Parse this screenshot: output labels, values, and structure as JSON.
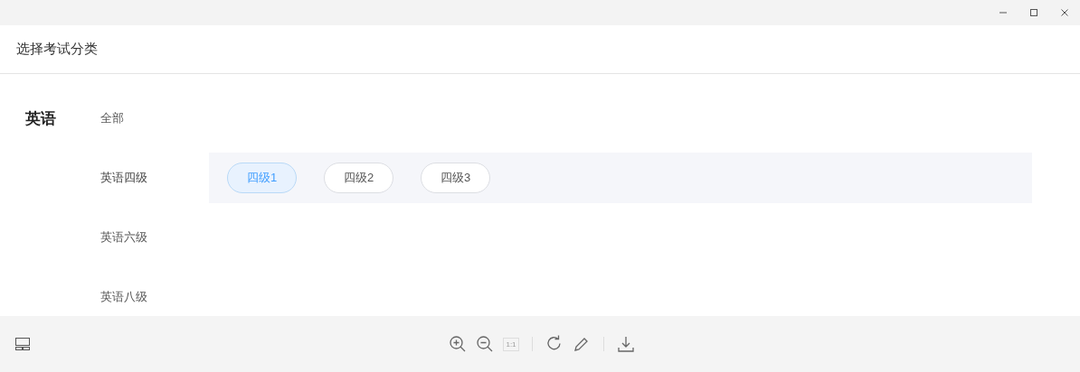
{
  "window": {
    "title": "选择考试分类"
  },
  "category": {
    "label": "英语"
  },
  "subcategories": [
    {
      "label": "全部",
      "expanded": false
    },
    {
      "label": "英语四级",
      "expanded": true,
      "options": [
        {
          "label": "四级1",
          "selected": true
        },
        {
          "label": "四级2",
          "selected": false
        },
        {
          "label": "四级3",
          "selected": false
        }
      ]
    },
    {
      "label": "英语六级",
      "expanded": false
    },
    {
      "label": "英语八级",
      "expanded": false
    }
  ],
  "toolbar": {
    "actual_size": {
      "label": "1:1",
      "disabled": true
    }
  }
}
